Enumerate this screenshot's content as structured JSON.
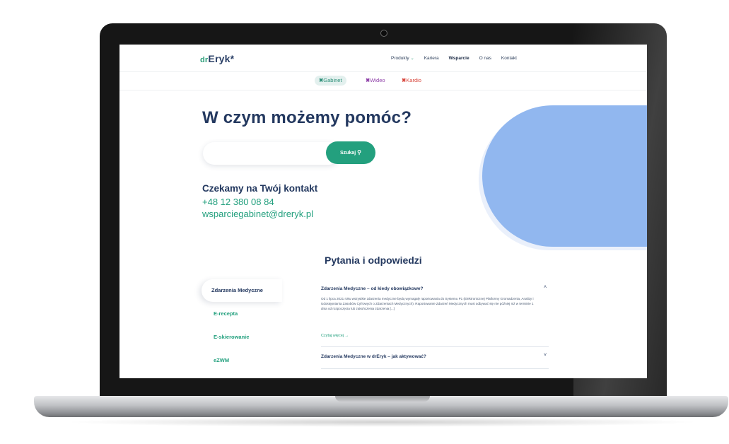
{
  "header": {
    "logo_prefix": "dr",
    "logo_main": "Eryk*",
    "nav": [
      {
        "label": "Produkty"
      },
      {
        "label": "Kariera"
      },
      {
        "label": "Wsparcie"
      },
      {
        "label": "O nas"
      },
      {
        "label": "Kontakt"
      }
    ]
  },
  "products": [
    {
      "mark": "✖",
      "label": "Gabinet"
    },
    {
      "mark": "✖",
      "label": "Wideo"
    },
    {
      "mark": "✖",
      "label": "Kardio"
    }
  ],
  "hero": {
    "title": "W czym możemy pomóc?",
    "search_placeholder": "",
    "search_button": "Szukaj"
  },
  "contact": {
    "title": "Czekamy na Twój kontakt",
    "phone": "+48 12 380 08 84",
    "email": "wsparciegabinet@dreryk.pl"
  },
  "faq": {
    "title": "Pytania i odpowiedzi",
    "tabs": [
      "Zdarzenia Medyczne",
      "E-recepta",
      "E-skierowanie",
      "eZWM"
    ],
    "q1": "Zdarzenia Medyczne – od kiedy obowiązkowe?",
    "a1": "Od 1 lipca 2021 roku wszystkie zdarzenia medyczne będą wymagały raportowania do Systemu P1 (Elektronicznej Platformy Gromadzenia, Analizy i Udostępniania Zasobów Cyfrowych o Zdarzeniach Medycznych). Raportowanie Zdarzeń Medycznych musi odbywać się nie później niż w terminie 1 dnia od rozpoczęcia lub zakończenia zdarzenia [...]",
    "more": "Czytaj więcej",
    "q2": "Zdarzenia Medyczne w drEryk – jak aktywować?"
  },
  "colors": {
    "accent": "#23a07e",
    "navy": "#23385f",
    "blob": "#91b7ef",
    "wideo": "#8e3fa8",
    "kardio": "#d8473d"
  }
}
